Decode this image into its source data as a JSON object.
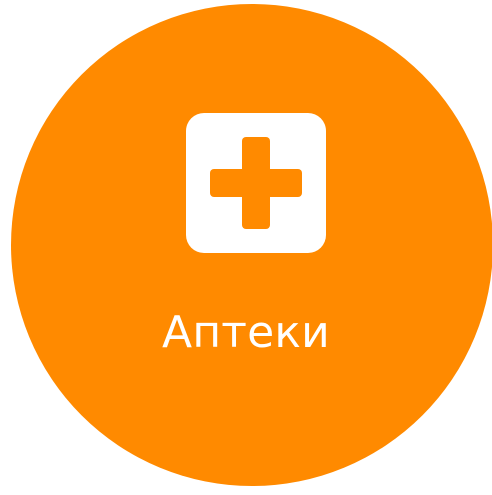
{
  "tile": {
    "label": "Аптеки",
    "icon": "medical-cross-icon",
    "accent_color": "#ff8a00",
    "icon_bg_color": "#ffffff",
    "text_color": "#ffffff"
  }
}
